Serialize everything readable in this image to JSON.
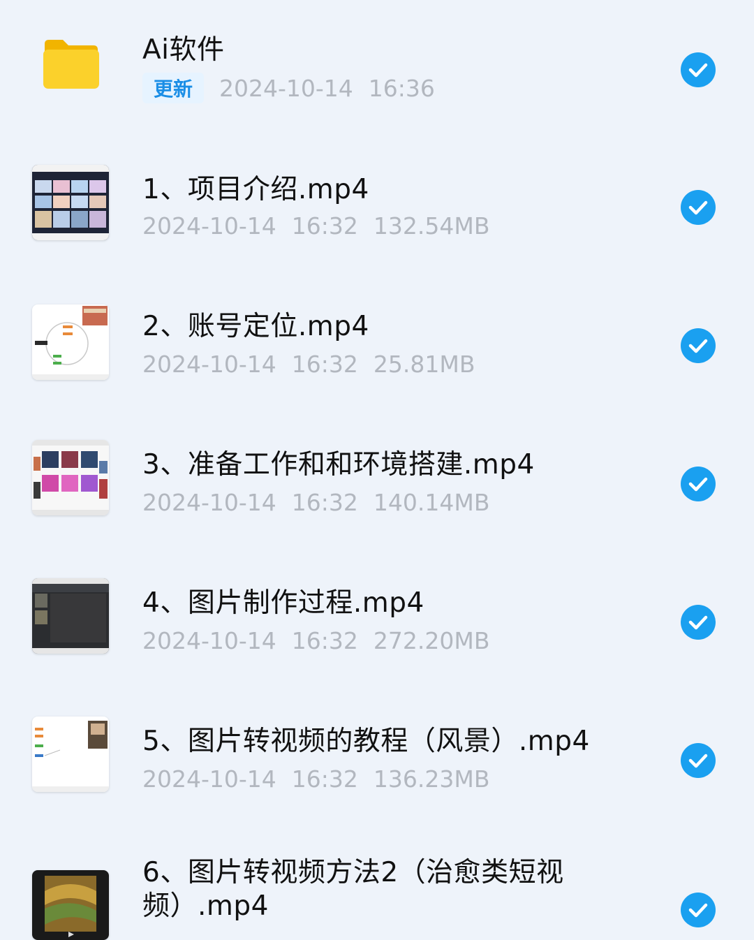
{
  "files": [
    {
      "type": "folder",
      "icon": "folder-icon",
      "name": "Ai软件",
      "badge": "更新",
      "date": "2024-10-14",
      "time": "16:36",
      "checked": true
    },
    {
      "type": "video",
      "icon": "video-thumbnail",
      "name": "1、项目介绍.mp4",
      "date": "2024-10-14",
      "time": "16:32",
      "size": "132.54MB",
      "checked": true
    },
    {
      "type": "video",
      "icon": "video-thumbnail",
      "name": "2、账号定位.mp4",
      "date": "2024-10-14",
      "time": "16:32",
      "size": "25.81MB",
      "checked": true
    },
    {
      "type": "video",
      "icon": "video-thumbnail",
      "name": "3、准备工作和和环境搭建.mp4",
      "date": "2024-10-14",
      "time": "16:32",
      "size": "140.14MB",
      "checked": true
    },
    {
      "type": "video",
      "icon": "video-thumbnail",
      "name": "4、图片制作过程.mp4",
      "date": "2024-10-14",
      "time": "16:32",
      "size": "272.20MB",
      "checked": true
    },
    {
      "type": "video",
      "icon": "video-thumbnail",
      "name": "5、图片转视频的教程（风景）.mp4",
      "date": "2024-10-14",
      "time": "16:32",
      "size": "136.23MB",
      "checked": true
    },
    {
      "type": "video",
      "icon": "video-thumbnail",
      "name": "6、图片转视频方法2（治愈类短视频）.mp4",
      "checked": true
    }
  ],
  "colors": {
    "accent": "#1aa0f0",
    "folder": "#f8c91a",
    "badge": "#1b8ee6"
  }
}
